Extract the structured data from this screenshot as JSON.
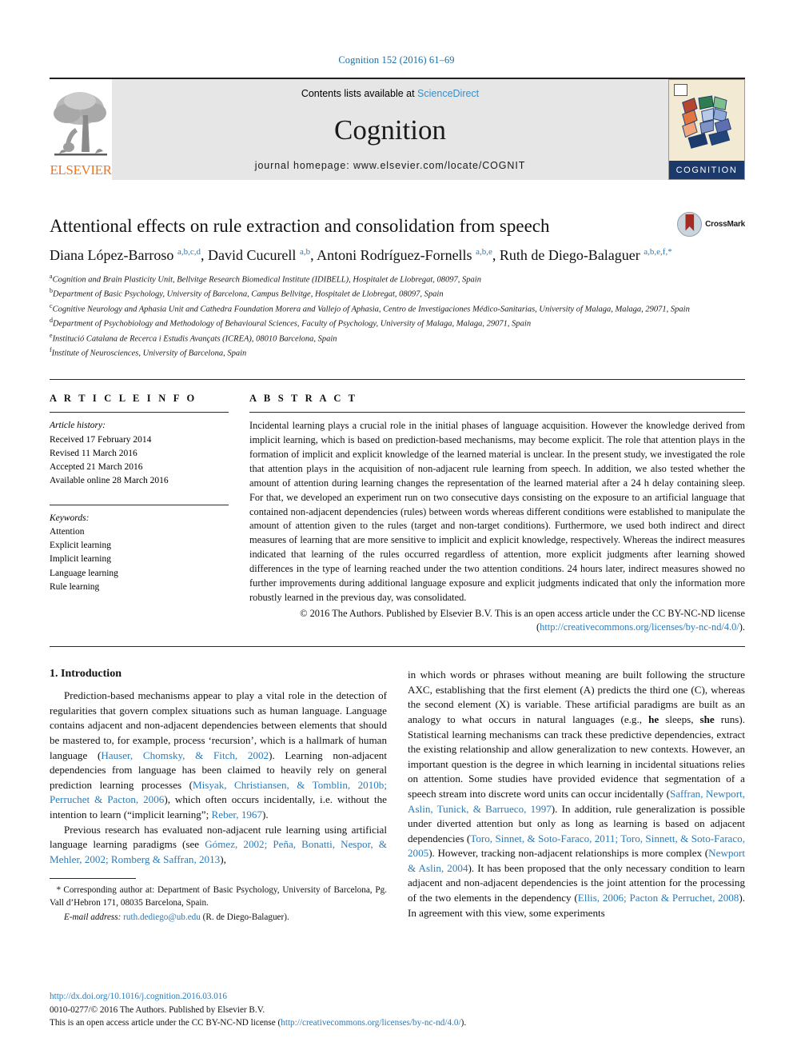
{
  "running_head": "Cognition 152 (2016) 61–69",
  "masthead": {
    "contents_prefix": "Contents lists available at ",
    "sciencedirect": "ScienceDirect",
    "journal_name": "Cognition",
    "homepage": "journal homepage: www.elsevier.com/locate/COGNIT",
    "elsevier_wordmark": "ELSEVIER",
    "cover_label": "COGNITION"
  },
  "article": {
    "title": "Attentional effects on rule extraction and consolidation from speech",
    "crossmark_label": "CrossMark",
    "authors_html": "Diana López-Barroso <sup class=\"aff-mark\">a,b,c,d</sup>, David Cucurell <sup class=\"aff-mark\">a,b</sup>, Antoni Rodríguez-Fornells <sup class=\"aff-mark\">a,b,e</sup>, Ruth de Diego-Balaguer <sup class=\"aff-mark\">a,b,e,f,</sup><sup class=\"aff-mark\">*</sup>",
    "affiliations": [
      "Cognition and Brain Plasticity Unit, Bellvitge Research Biomedical Institute (IDIBELL), Hospitalet de Llobregat, 08097, Spain",
      "Department of Basic Psychology, University of Barcelona, Campus Bellvitge, Hospitalet de Llobregat, 08097, Spain",
      "Cognitive Neurology and Aphasia Unit and Cathedra Foundation Morera and Vallejo of Aphasia, Centro de Investigaciones Médico-Sanitarias, University of Malaga, Malaga, 29071, Spain",
      "Department of Psychobiology and Methodology of Behavioural Sciences, Faculty of Psychology, University of Malaga, Malaga, 29071, Spain",
      "Institució Catalana de Recerca i Estudis Avançats (ICREA), 08010 Barcelona, Spain",
      "Institute of Neurosciences, University of Barcelona, Spain"
    ],
    "affiliation_marks": [
      "a",
      "b",
      "c",
      "d",
      "e",
      "f"
    ]
  },
  "article_info": {
    "heading": "A R T I C L E  I N F O",
    "history_label": "Article history:",
    "history": [
      "Received 17 February 2014",
      "Revised 11 March 2016",
      "Accepted 21 March 2016",
      "Available online 28 March 2016"
    ],
    "keywords_label": "Keywords:",
    "keywords": [
      "Attention",
      "Explicit learning",
      "Implicit learning",
      "Language learning",
      "Rule learning"
    ]
  },
  "abstract": {
    "heading": "A B S T R A C T",
    "text": "Incidental learning plays a crucial role in the initial phases of language acquisition. However the knowledge derived from implicit learning, which is based on prediction-based mechanisms, may become explicit. The role that attention plays in the formation of implicit and explicit knowledge of the learned material is unclear. In the present study, we investigated the role that attention plays in the acquisition of non-adjacent rule learning from speech. In addition, we also tested whether the amount of attention during learning changes the representation of the learned material after a 24 h delay containing sleep. For that, we developed an experiment run on two consecutive days consisting on the exposure to an artificial language that contained non-adjacent dependencies (rules) between words whereas different conditions were established to manipulate the amount of attention given to the rules (target and non-target conditions). Furthermore, we used both indirect and direct measures of learning that are more sensitive to implicit and explicit knowledge, respectively. Whereas the indirect measures indicated that learning of the rules occurred regardless of attention, more explicit judgments after learning showed differences in the type of learning reached under the two attention conditions. 24 hours later, indirect measures showed no further improvements during additional language exposure and explicit judgments indicated that only the information more robustly learned in the previous day, was consolidated.",
    "copyright_prefix": "© 2016 The Authors. Published by Elsevier B.V. This is an open access article under the CC BY-NC-ND license (",
    "copyright_link": "http://creativecommons.org/licenses/by-nc-nd/4.0/",
    "copyright_suffix": ")."
  },
  "introduction": {
    "heading": "1. Introduction",
    "left_paragraph_1_html": "Prediction-based mechanisms appear to play a vital role in the detection of regularities that govern complex situations such as human language. Language contains adjacent and non-adjacent dependencies between elements that should be mastered to, for example, process &lsquo;recursion&rsquo;, which is a hallmark of human language (<span class=\"cite\">Hauser, Chomsky, &amp; Fitch, 2002</span>). Learning non-adjacent dependencies from language has been claimed to heavily rely on general prediction learning processes (<span class=\"cite\">Misyak, Christiansen, &amp; Tomblin, 2010b; Perruchet &amp; Pacton, 2006</span>), which often occurs incidentally, i.e. without the intention to learn (&ldquo;implicit learning&rdquo;; <span class=\"cite\">Reber, 1967</span>).",
    "left_paragraph_2_html": "Previous research has evaluated non-adjacent rule learning using artificial language learning paradigms (see <span class=\"cite\">Gómez, 2002; Peña, Bonatti, Nespor, &amp; Mehler, 2002; Romberg &amp; Saffran, 2013</span>),",
    "right_paragraph_html": "in which words or phrases without meaning are built following the structure AXC, establishing that the first element (A) predicts the third one (C), whereas the second element (X) is variable. These artificial paradigms are built as an analogy to what occurs in natural languages (e.g., <b>he</b> sleeps, <b>she</b> runs). Statistical learning mechanisms can track these predictive dependencies, extract the existing relationship and allow generalization to new contexts. However, an important question is the degree in which learning in incidental situations relies on attention. Some studies have provided evidence that segmentation of a speech stream into discrete word units can occur incidentally (<span class=\"cite\">Saffran, Newport, Aslin, Tunick, &amp; Barrueco, 1997</span>). In addition, rule generalization is possible under diverted attention but only as long as learning is based on adjacent dependencies (<span class=\"cite\">Toro, Sinnet, &amp; Soto-Faraco, 2011; Toro, Sinnett, &amp; Soto-Faraco, 2005</span>). However, tracking non-adjacent relationships is more complex (<span class=\"cite\">Newport &amp; Aslin, 2004</span>). It has been proposed that the only necessary condition to learn adjacent and non-adjacent dependencies is the joint attention for the processing of the two elements in the dependency (<span class=\"cite\">Ellis, 2006; Pacton &amp; Perruchet, 2008</span>). In agreement with this view, some experiments"
  },
  "footnotes": {
    "corresponding_html": "<span class=\"it\">*</span> Corresponding author at: Department of Basic Psychology, University of Barcelona, Pg. Vall d&rsquo;Hebron 171, 08035 Barcelona, Spain.",
    "email_label": "E-mail address:",
    "email": "ruth.dediego@ub.edu",
    "email_owner": "(R. de Diego-Balaguer)."
  },
  "page_footer": {
    "doi": "http://dx.doi.org/10.1016/j.cognition.2016.03.016",
    "issn_line": "0010-0277/© 2016 The Authors. Published by Elsevier B.V.",
    "license_prefix": "This is an open access article under the CC BY-NC-ND license (",
    "license_link": "http://creativecommons.org/licenses/by-nc-nd/4.0/",
    "license_suffix": ")."
  },
  "colors": {
    "link": "#2b7bb9",
    "elsevier_orange": "#ef7622",
    "masthead_gray": "#e6e6e6",
    "cover_navy": "#1b3a6b",
    "crossmark_red": "#a32b22"
  }
}
